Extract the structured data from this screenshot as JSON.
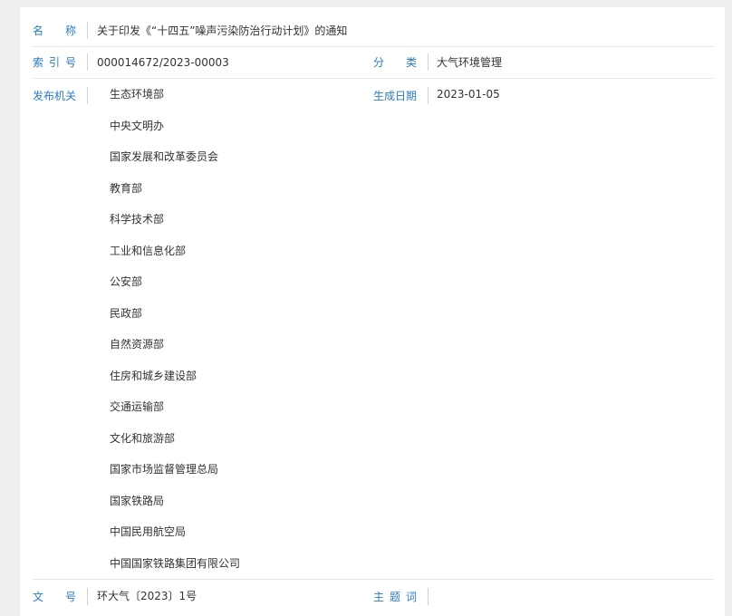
{
  "name": {
    "label": [
      "名",
      "称"
    ],
    "value": "关于印发《“十四五”噪声污染防治行动计划》的通知"
  },
  "index": {
    "label": [
      "索",
      "引",
      "号"
    ],
    "value": "000014672/2023-00003"
  },
  "category": {
    "label": [
      "分",
      "类"
    ],
    "value": "大气环境管理"
  },
  "publisher": {
    "label": "发布机关",
    "orgs": [
      "生态环境部",
      "中央文明办",
      "国家发展和改革委员会",
      "教育部",
      "科学技术部",
      "工业和信息化部",
      "公安部",
      "民政部",
      "自然资源部",
      "住房和城乡建设部",
      "交通运输部",
      "文化和旅游部",
      "国家市场监督管理总局",
      "国家铁路局",
      "中国民用航空局",
      "中国国家铁路集团有限公司"
    ]
  },
  "created_date": {
    "label": "生成日期",
    "value": "2023-01-05"
  },
  "doc_number": {
    "label": [
      "文",
      "号"
    ],
    "value": "环大气〔2023〕1号"
  },
  "subject": {
    "label": [
      "主",
      "题",
      "词"
    ],
    "value": ""
  }
}
